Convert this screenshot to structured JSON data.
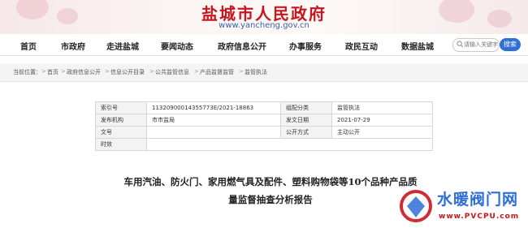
{
  "site": {
    "title": "盐城市人民政府",
    "url": "www.yancheng.gov.cn"
  },
  "nav": {
    "items": [
      "首页",
      "市政府",
      "走进盐城",
      "要闻动态",
      "政府信息公开",
      "办事服务",
      "政民互动",
      "数据盐城"
    ]
  },
  "search": {
    "placeholder": "请输入关键字",
    "button": "搜索"
  },
  "breadcrumb": {
    "prefix": "当前位置：",
    "items": [
      "首页",
      "政府信息公开",
      "信息公开目录",
      "公共监管信息",
      "产品监督监管",
      "监管执法"
    ],
    "separator": ">"
  },
  "meta": {
    "index_label": "索引号",
    "index_value": "11320900014355773E/2021-18863",
    "category_label": "组配分类",
    "category_value": "监管执法",
    "issuer_label": "发布机构",
    "issuer_value": "市市监局",
    "date_label": "发文日期",
    "date_value": "2021-07-29",
    "docno_label": "文号",
    "docno_value": "",
    "public_label": "公开方式",
    "public_value": "主动公开",
    "validity_label": "时效",
    "validity_value": ""
  },
  "document": {
    "title_line1": "车用汽油、防火门、家用燃气具及配件、塑料购物袋等10个品种产品质",
    "title_line2": "量监督抽查分析报告"
  },
  "watermark": {
    "text": "水暖阀门网",
    "url": "www.PVCPU.com"
  },
  "colors": {
    "brand_red": "#c8161d",
    "link_blue": "#2f6fd6"
  }
}
